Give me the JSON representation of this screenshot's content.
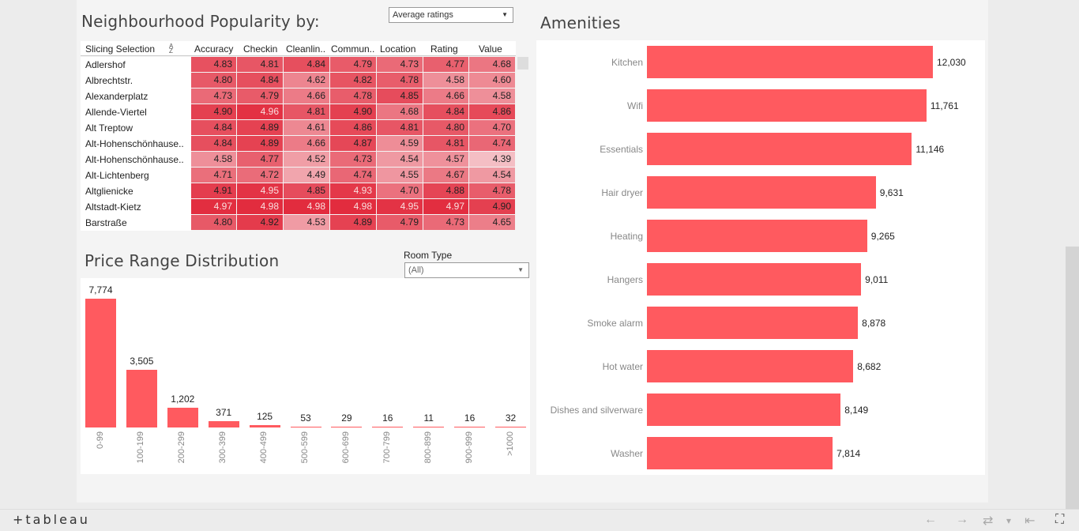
{
  "popularity": {
    "title": "Neighbourhood Popularity by:",
    "dropdown_value": "Average ratings",
    "columns": [
      "Slicing Selection",
      "Accuracy",
      "Checkin",
      "Cleanlin..",
      "Commun..",
      "Location",
      "Rating",
      "Value"
    ],
    "rows": [
      {
        "name": "Adlershof",
        "values": [
          "4.83",
          "4.81",
          "4.84",
          "4.79",
          "4.73",
          "4.77",
          "4.68"
        ]
      },
      {
        "name": "Albrechtstr.",
        "values": [
          "4.80",
          "4.84",
          "4.62",
          "4.82",
          "4.78",
          "4.58",
          "4.60"
        ]
      },
      {
        "name": "Alexanderplatz",
        "values": [
          "4.73",
          "4.79",
          "4.66",
          "4.78",
          "4.85",
          "4.66",
          "4.58"
        ]
      },
      {
        "name": "Allende-Viertel",
        "values": [
          "4.90",
          "4.96",
          "4.81",
          "4.90",
          "4.68",
          "4.84",
          "4.86"
        ]
      },
      {
        "name": "Alt  Treptow",
        "values": [
          "4.84",
          "4.89",
          "4.61",
          "4.86",
          "4.81",
          "4.80",
          "4.70"
        ]
      },
      {
        "name": "Alt-Hohenschönhause..",
        "values": [
          "4.84",
          "4.89",
          "4.66",
          "4.87",
          "4.59",
          "4.81",
          "4.74"
        ]
      },
      {
        "name": "Alt-Hohenschönhause..",
        "values": [
          "4.58",
          "4.77",
          "4.52",
          "4.73",
          "4.54",
          "4.57",
          "4.39"
        ]
      },
      {
        "name": "Alt-Lichtenberg",
        "values": [
          "4.71",
          "4.72",
          "4.49",
          "4.74",
          "4.55",
          "4.67",
          "4.54"
        ]
      },
      {
        "name": "Altglienicke",
        "values": [
          "4.91",
          "4.95",
          "4.85",
          "4.93",
          "4.70",
          "4.88",
          "4.78"
        ]
      },
      {
        "name": "Altstadt-Kietz",
        "values": [
          "4.97",
          "4.98",
          "4.98",
          "4.98",
          "4.95",
          "4.97",
          "4.90"
        ]
      },
      {
        "name": "Barstraße",
        "values": [
          "4.80",
          "4.92",
          "4.53",
          "4.89",
          "4.79",
          "4.73",
          "4.65"
        ]
      }
    ]
  },
  "price": {
    "title": "Price Range Distribution",
    "room_type_label": "Room Type",
    "room_type_value": "(All)"
  },
  "amenities": {
    "title": "Amenities"
  },
  "chart_data": [
    {
      "type": "bar",
      "title": "Price Range Distribution",
      "categories": [
        "0-99",
        "100-199",
        "200-299",
        "300-399",
        "400-499",
        "500-599",
        "600-699",
        "700-799",
        "800-899",
        "900-999",
        ">1000"
      ],
      "values": [
        7774,
        3505,
        1202,
        371,
        125,
        53,
        29,
        16,
        11,
        16,
        32
      ],
      "labels": [
        "7,774",
        "3,505",
        "1,202",
        "371",
        "125",
        "53",
        "29",
        "16",
        "11",
        "16",
        "32"
      ]
    },
    {
      "type": "bar",
      "title": "Amenities",
      "orientation": "horizontal",
      "categories": [
        "Kitchen",
        "Wifi",
        "Essentials",
        "Hair dryer",
        "Heating",
        "Hangers",
        "Smoke alarm",
        "Hot water",
        "Dishes and silverware",
        "Washer"
      ],
      "values": [
        12030,
        11761,
        11146,
        9631,
        9265,
        9011,
        8878,
        8682,
        8149,
        7814
      ],
      "labels": [
        "12,030",
        "11,761",
        "11,146",
        "9,631",
        "9,265",
        "9,011",
        "8,878",
        "8,682",
        "8,149",
        "7,814"
      ]
    }
  ],
  "footer": {
    "logo": "+tableau",
    "undo": "←",
    "redo": "→",
    "revert": "⇄",
    "menu": "▾",
    "back": "⇤",
    "fullscreen": "⛶"
  },
  "colors": {
    "bar": "#ff5a5f"
  }
}
